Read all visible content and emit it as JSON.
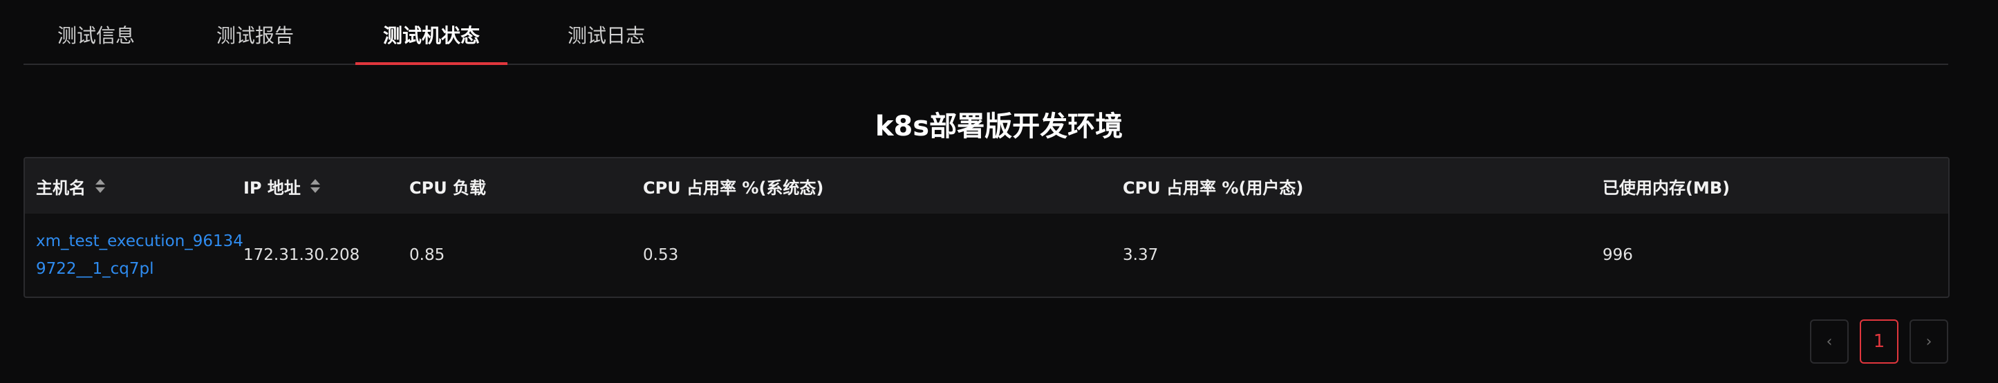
{
  "tabs": [
    {
      "label": "测试信息"
    },
    {
      "label": "测试报告"
    },
    {
      "label": "测试机状态",
      "active": true
    },
    {
      "label": "测试日志"
    }
  ],
  "title": "k8s部署版开发环境",
  "table": {
    "headers": [
      "主机名",
      "IP 地址",
      "CPU 负载",
      "CPU 占用率 %(系统态)",
      "CPU 占用率 %(用户态)",
      "已使用内存(MB)"
    ],
    "rows": [
      {
        "hostname": "xm_test_execution_961349722__1_cq7pl",
        "ip": "172.31.30.208",
        "cpu_load": "0.85",
        "cpu_sys": "0.53",
        "cpu_user": "3.37",
        "memory_used": "996"
      }
    ]
  },
  "pagination": {
    "prev_icon": "chevron-left-icon",
    "current": "1",
    "next_icon": "chevron-right-icon"
  },
  "colors": {
    "accent": "#e0363d",
    "link": "#2f8cf0",
    "background": "#0b0b0c"
  }
}
